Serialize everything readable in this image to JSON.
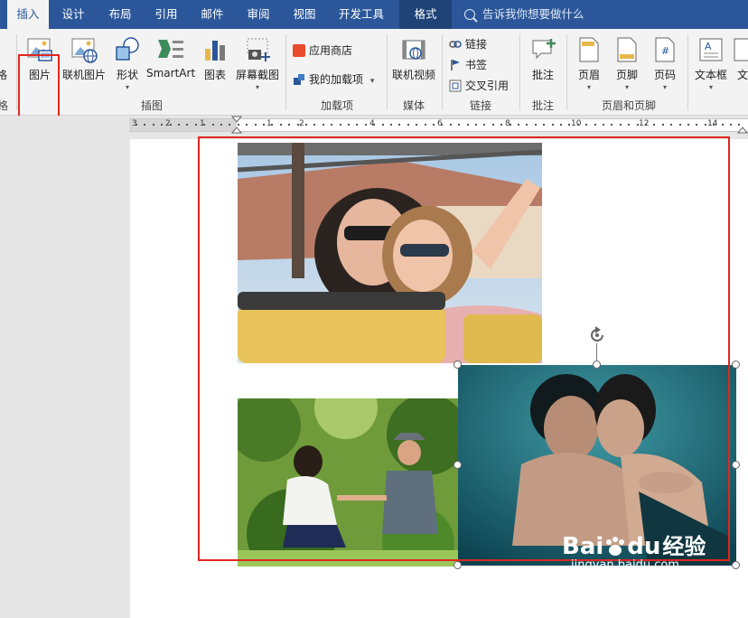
{
  "tabs": [
    {
      "label": "插入",
      "active": true
    },
    {
      "label": "设计"
    },
    {
      "label": "布局"
    },
    {
      "label": "引用"
    },
    {
      "label": "邮件"
    },
    {
      "label": "审阅"
    },
    {
      "label": "视图"
    },
    {
      "label": "开发工具"
    },
    {
      "label": "格式",
      "context": true
    }
  ],
  "tell_me": "告诉我你想要做什么",
  "ribbon": {
    "partial_left": "格",
    "picture": "图片",
    "online_picture": "联机图片",
    "shapes": "形状",
    "smartart": "SmartArt",
    "chart": "图表",
    "screenshot": "屏幕截图",
    "app_store": "应用商店",
    "my_addins": "我的加载项",
    "online_video": "联机视频",
    "link": "链接",
    "bookmark": "书签",
    "cross_ref": "交叉引用",
    "comment": "批注",
    "header": "页眉",
    "footer": "页脚",
    "page_number": "页码",
    "text_box": "文本框",
    "partial_right": "文",
    "groups": {
      "left_partial": "格",
      "illustrations": "插图",
      "addins": "加载项",
      "media": "媒体",
      "links": "链接",
      "comments": "批注",
      "header_footer": "页眉和页脚"
    }
  },
  "ruler": {
    "numbers": [
      "3",
      "2",
      "1",
      "1",
      "2",
      "4",
      "6",
      "8",
      "10",
      "12",
      "14"
    ]
  },
  "watermark": {
    "brand": "Bai",
    "paw": "du",
    "suffix": "经验",
    "url": "jingyan.baidu.com"
  },
  "colors": {
    "accent": "#2b579a",
    "highlight": "#e0261f"
  }
}
